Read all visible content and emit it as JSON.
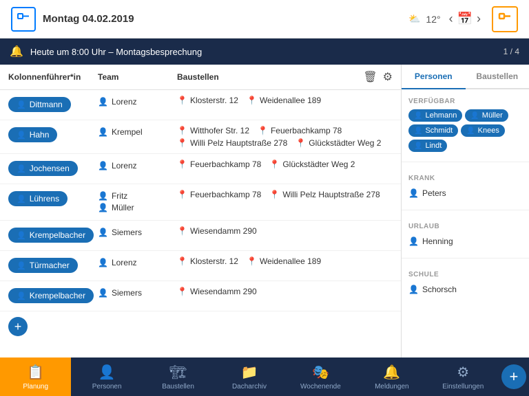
{
  "header": {
    "logo_symbol": "🔵",
    "date": "Montag 04.02.2019",
    "temp": "12°",
    "prev_label": "‹",
    "next_label": "›",
    "app_icon": "⊓"
  },
  "notification": {
    "text": "Heute um 8:00 Uhr – Montagsbesprechung",
    "badge": "1 / 4"
  },
  "table": {
    "col_kolonnen": "Kolonnenführer*in",
    "col_team": "Team",
    "col_baustellen": "Baustellen",
    "rows": [
      {
        "kolonnen": "Dittmann",
        "team": [
          "Lorenz"
        ],
        "locations": [
          "Klosterstr. 12",
          "Weidenallee 189"
        ]
      },
      {
        "kolonnen": "Hahn",
        "team": [
          "Krempel"
        ],
        "locations": [
          "Witthofer Str. 12",
          "Feuerbachkamp 78",
          "Willi Pelz Hauptstraße 278",
          "Glückstädter Weg 2"
        ]
      },
      {
        "kolonnen": "Jochensen",
        "team": [
          "Lorenz"
        ],
        "locations": [
          "Feuerbachkamp 78",
          "Glückstädter Weg 2"
        ]
      },
      {
        "kolonnen": "Lührens",
        "team": [
          "Fritz",
          "Müller"
        ],
        "locations": [
          "Feuerbachkamp 78",
          "Willi Pelz Hauptstraße 278"
        ]
      },
      {
        "kolonnen": "Krempelbacher",
        "team": [
          "Siemers"
        ],
        "locations": [
          "Wiesendamm 290"
        ]
      },
      {
        "kolonnen": "Türmacher",
        "team": [
          "Lorenz"
        ],
        "locations": [
          "Klosterstr. 12",
          "Weidenallee 189"
        ]
      },
      {
        "kolonnen": "Krempelbacher",
        "team": [
          "Siemers"
        ],
        "locations": [
          "Wiesendamm 290"
        ]
      }
    ]
  },
  "right_panel": {
    "tab_personen": "Personen",
    "tab_baustellen": "Baustellen",
    "sections": [
      {
        "title": "VERFÜGBAR",
        "type": "badges",
        "people": [
          "Lehmann",
          "Müller",
          "Schmidt",
          "Knees",
          "Lindt"
        ]
      },
      {
        "title": "KRANK",
        "type": "list",
        "people": [
          "Peters"
        ]
      },
      {
        "title": "URLAUB",
        "type": "list",
        "people": [
          "Henning"
        ]
      },
      {
        "title": "SCHULE",
        "type": "list",
        "people": [
          "Schorsch"
        ]
      }
    ]
  },
  "bottom_nav": [
    {
      "label": "Planung",
      "icon": "📋",
      "active": true
    },
    {
      "label": "Personen",
      "icon": "👤"
    },
    {
      "label": "Baustellen",
      "icon": "🏗"
    },
    {
      "label": "Dacharchiv",
      "icon": "📁"
    },
    {
      "label": "Wochenende",
      "icon": "🎭"
    },
    {
      "label": "Meldungen",
      "icon": "🔔"
    },
    {
      "label": "Einstellungen",
      "icon": "⚙"
    }
  ]
}
